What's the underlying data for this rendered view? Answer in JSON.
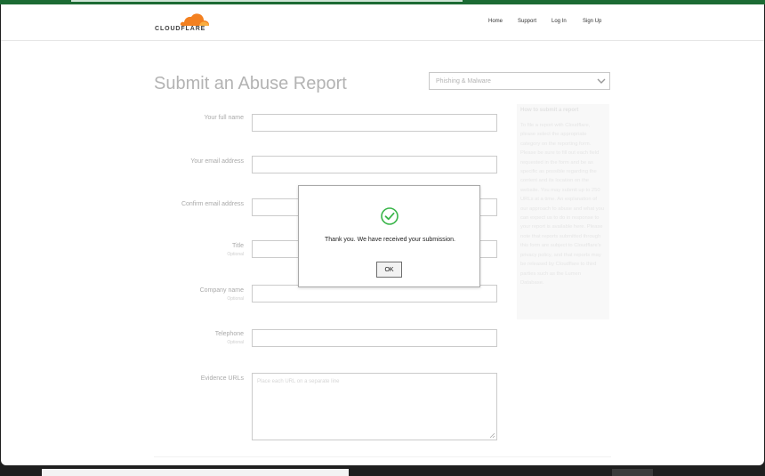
{
  "brand": {
    "logo_text": "CLOUDFLARE",
    "color": "#f38020"
  },
  "nav": {
    "home": "Home",
    "support": "Support",
    "login": "Log In",
    "signup": "Sign Up"
  },
  "page": {
    "title": "Submit an Abuse Report"
  },
  "category": {
    "selected": "Phishing & Malware"
  },
  "form": {
    "full_name": {
      "label": "Your full name",
      "value": ""
    },
    "email": {
      "label": "Your email address",
      "value": ""
    },
    "confirm_email": {
      "label": "Confirm email address",
      "value": ""
    },
    "title_field": {
      "label": "Title",
      "optional": "Optional",
      "value": ""
    },
    "company": {
      "label": "Company name",
      "optional": "Optional",
      "value": ""
    },
    "telephone": {
      "label": "Telephone",
      "optional": "Optional",
      "value": ""
    },
    "evidence": {
      "label": "Evidence URLs",
      "placeholder": "Place each URL on a separate line"
    }
  },
  "help": {
    "title": "How to submit a report",
    "body": "To file a report with Cloudflare, please select the appropriate category on the reporting form. Please be sure to fill out each field requested in the form and be as specific as possible regarding the content and its location on the website. You may submit up to 250 URLs at a time. An explanation of our approach to abuse and what you can expect us to do in response to your report is available here. Please note that reports submitted through this form are subject to Cloudflare's privacy policy, and that reports may be released by Cloudflare to third parties such as the Lumen Database."
  },
  "modal": {
    "message": "Thank you. We have received your submission.",
    "ok_label": "OK",
    "icon": "check-circle-icon",
    "icon_color": "#3ab54a"
  }
}
